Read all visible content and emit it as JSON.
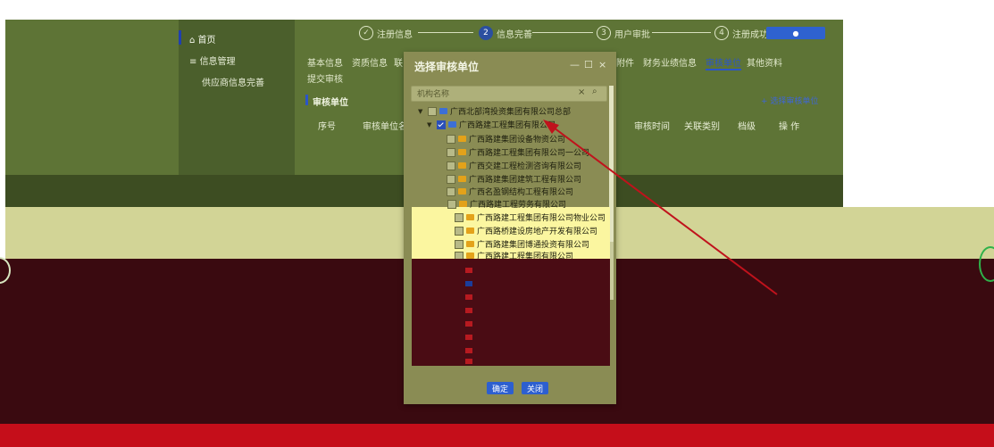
{
  "sidebar": {
    "items": [
      {
        "label": "首页",
        "icon": "home-icon"
      },
      {
        "label": "信息管理",
        "icon": "list-icon"
      },
      {
        "label": "供应商信息完善",
        "icon": ""
      }
    ]
  },
  "stepper": {
    "steps": [
      {
        "num": "✓",
        "label": "注册信息"
      },
      {
        "num": "2",
        "label": "信息完善"
      },
      {
        "num": "3",
        "label": "用户审批"
      },
      {
        "num": "4",
        "label": "注册成功"
      }
    ]
  },
  "tabs": {
    "items": [
      "基本信息",
      "资质信息",
      "联",
      "附件",
      "财务业绩信息",
      "审核单位",
      "其他资料"
    ],
    "active": "审核单位",
    "submit": "提交审核"
  },
  "section": {
    "title": "审核单位",
    "add_button": "+ 选择审核单位",
    "columns": [
      "序号",
      "审核单位名",
      "审核时间",
      "关联类别",
      "档级",
      "操 作"
    ]
  },
  "modal": {
    "title": "选择审核单位",
    "controls": [
      "—",
      "☐",
      "×"
    ],
    "search_placeholder": "机构名称",
    "root": "广西北部湾投资集团有限公司总部",
    "parent": "广西路建工程集团有限公司",
    "children": [
      "广西路建集团设备物资公司",
      "广西路建工程集团有限公司一公司",
      "广西交建工程检测咨询有限公司",
      "广西路建集团建筑工程有限公司",
      "广西名盈钢结构工程有限公司",
      "广西路建工程劳务有限公司",
      "广西路建工程集团有限公司物业公司",
      "广西路桥建设房地产开发有限公司",
      "广西路建集团博通投资有限公司",
      "广西路建工程集团有限公司"
    ],
    "ok_label": "确定",
    "cancel_label": "关闭"
  },
  "colors": {
    "accent": "#2a55c9",
    "arrow": "#c0121c"
  }
}
